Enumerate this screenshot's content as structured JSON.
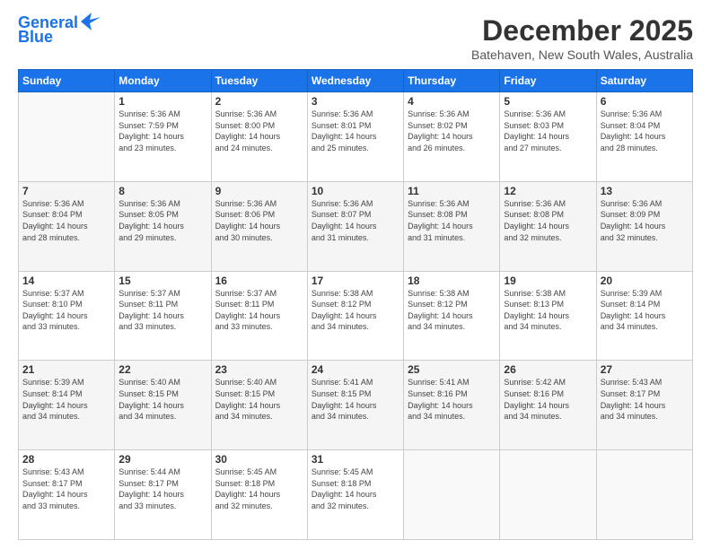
{
  "logo": {
    "line1": "General",
    "line2": "Blue"
  },
  "title": "December 2025",
  "location": "Batehaven, New South Wales, Australia",
  "weekdays": [
    "Sunday",
    "Monday",
    "Tuesday",
    "Wednesday",
    "Thursday",
    "Friday",
    "Saturday"
  ],
  "weeks": [
    [
      {
        "day": "",
        "info": ""
      },
      {
        "day": "1",
        "info": "Sunrise: 5:36 AM\nSunset: 7:59 PM\nDaylight: 14 hours\nand 23 minutes."
      },
      {
        "day": "2",
        "info": "Sunrise: 5:36 AM\nSunset: 8:00 PM\nDaylight: 14 hours\nand 24 minutes."
      },
      {
        "day": "3",
        "info": "Sunrise: 5:36 AM\nSunset: 8:01 PM\nDaylight: 14 hours\nand 25 minutes."
      },
      {
        "day": "4",
        "info": "Sunrise: 5:36 AM\nSunset: 8:02 PM\nDaylight: 14 hours\nand 26 minutes."
      },
      {
        "day": "5",
        "info": "Sunrise: 5:36 AM\nSunset: 8:03 PM\nDaylight: 14 hours\nand 27 minutes."
      },
      {
        "day": "6",
        "info": "Sunrise: 5:36 AM\nSunset: 8:04 PM\nDaylight: 14 hours\nand 28 minutes."
      }
    ],
    [
      {
        "day": "7",
        "info": "Sunrise: 5:36 AM\nSunset: 8:04 PM\nDaylight: 14 hours\nand 28 minutes."
      },
      {
        "day": "8",
        "info": "Sunrise: 5:36 AM\nSunset: 8:05 PM\nDaylight: 14 hours\nand 29 minutes."
      },
      {
        "day": "9",
        "info": "Sunrise: 5:36 AM\nSunset: 8:06 PM\nDaylight: 14 hours\nand 30 minutes."
      },
      {
        "day": "10",
        "info": "Sunrise: 5:36 AM\nSunset: 8:07 PM\nDaylight: 14 hours\nand 31 minutes."
      },
      {
        "day": "11",
        "info": "Sunrise: 5:36 AM\nSunset: 8:08 PM\nDaylight: 14 hours\nand 31 minutes."
      },
      {
        "day": "12",
        "info": "Sunrise: 5:36 AM\nSunset: 8:08 PM\nDaylight: 14 hours\nand 32 minutes."
      },
      {
        "day": "13",
        "info": "Sunrise: 5:36 AM\nSunset: 8:09 PM\nDaylight: 14 hours\nand 32 minutes."
      }
    ],
    [
      {
        "day": "14",
        "info": "Sunrise: 5:37 AM\nSunset: 8:10 PM\nDaylight: 14 hours\nand 33 minutes."
      },
      {
        "day": "15",
        "info": "Sunrise: 5:37 AM\nSunset: 8:11 PM\nDaylight: 14 hours\nand 33 minutes."
      },
      {
        "day": "16",
        "info": "Sunrise: 5:37 AM\nSunset: 8:11 PM\nDaylight: 14 hours\nand 33 minutes."
      },
      {
        "day": "17",
        "info": "Sunrise: 5:38 AM\nSunset: 8:12 PM\nDaylight: 14 hours\nand 34 minutes."
      },
      {
        "day": "18",
        "info": "Sunrise: 5:38 AM\nSunset: 8:12 PM\nDaylight: 14 hours\nand 34 minutes."
      },
      {
        "day": "19",
        "info": "Sunrise: 5:38 AM\nSunset: 8:13 PM\nDaylight: 14 hours\nand 34 minutes."
      },
      {
        "day": "20",
        "info": "Sunrise: 5:39 AM\nSunset: 8:14 PM\nDaylight: 14 hours\nand 34 minutes."
      }
    ],
    [
      {
        "day": "21",
        "info": "Sunrise: 5:39 AM\nSunset: 8:14 PM\nDaylight: 14 hours\nand 34 minutes."
      },
      {
        "day": "22",
        "info": "Sunrise: 5:40 AM\nSunset: 8:15 PM\nDaylight: 14 hours\nand 34 minutes."
      },
      {
        "day": "23",
        "info": "Sunrise: 5:40 AM\nSunset: 8:15 PM\nDaylight: 14 hours\nand 34 minutes."
      },
      {
        "day": "24",
        "info": "Sunrise: 5:41 AM\nSunset: 8:15 PM\nDaylight: 14 hours\nand 34 minutes."
      },
      {
        "day": "25",
        "info": "Sunrise: 5:41 AM\nSunset: 8:16 PM\nDaylight: 14 hours\nand 34 minutes."
      },
      {
        "day": "26",
        "info": "Sunrise: 5:42 AM\nSunset: 8:16 PM\nDaylight: 14 hours\nand 34 minutes."
      },
      {
        "day": "27",
        "info": "Sunrise: 5:43 AM\nSunset: 8:17 PM\nDaylight: 14 hours\nand 34 minutes."
      }
    ],
    [
      {
        "day": "28",
        "info": "Sunrise: 5:43 AM\nSunset: 8:17 PM\nDaylight: 14 hours\nand 33 minutes."
      },
      {
        "day": "29",
        "info": "Sunrise: 5:44 AM\nSunset: 8:17 PM\nDaylight: 14 hours\nand 33 minutes."
      },
      {
        "day": "30",
        "info": "Sunrise: 5:45 AM\nSunset: 8:18 PM\nDaylight: 14 hours\nand 32 minutes."
      },
      {
        "day": "31",
        "info": "Sunrise: 5:45 AM\nSunset: 8:18 PM\nDaylight: 14 hours\nand 32 minutes."
      },
      {
        "day": "",
        "info": ""
      },
      {
        "day": "",
        "info": ""
      },
      {
        "day": "",
        "info": ""
      }
    ]
  ]
}
